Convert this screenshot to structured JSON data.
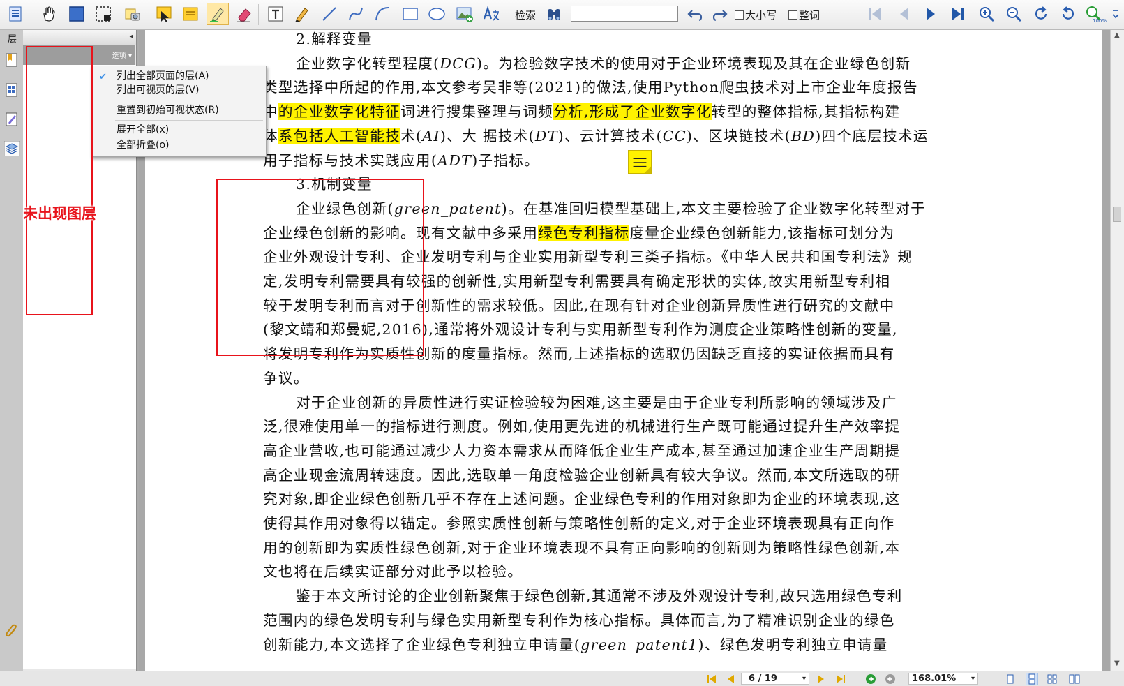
{
  "toolbar": {
    "search_label": "检索",
    "search_value": "",
    "match_case_label": "大小写",
    "whole_word_label": "整词",
    "zoom_badge": "100%",
    "icons": [
      "page-list-icon",
      "hand-tool-icon",
      "select-area-icon",
      "marquee-select-icon",
      "snapshot-icon",
      "select-text-icon",
      "sticky-note-icon",
      "highlight-icon",
      "eraser-icon",
      "text-box-icon",
      "pencil-icon",
      "line-icon",
      "curve-icon",
      "arc-icon",
      "rectangle-icon",
      "ellipse-icon",
      "image-icon",
      "translate-icon",
      "binoculars-icon",
      "undo-icon",
      "redo-icon",
      "first-page-icon",
      "prev-page-icon",
      "next-page-icon",
      "last-page-icon",
      "zoom-in-icon",
      "zoom-out-icon",
      "rotate-cw-icon",
      "rotate-ccw-icon",
      "zoom-100-icon",
      "toolbar-overflow-icon"
    ]
  },
  "panel": {
    "title": "层",
    "options_label": "选项",
    "collapse_glyph": "◂"
  },
  "menu": {
    "items": [
      {
        "label": "列出全部页面的层(A)",
        "checked": true
      },
      {
        "label": "列出可视页的层(V)",
        "checked": false
      },
      {
        "label": "重置到初始可视状态(R)",
        "checked": false
      },
      {
        "label": "展开全部(x)",
        "checked": false
      },
      {
        "label": "全部折叠(o)",
        "checked": false
      }
    ]
  },
  "annotation": {
    "text": "未出现图层",
    "color": "#e8131b"
  },
  "document": {
    "highlight_color": "#fff200",
    "lines": [
      [
        {
          "t": "2.解释变量"
        }
      ],
      [
        {
          "t": "企业数字化转型程度("
        },
        {
          "t": "DCG",
          "i": true
        },
        {
          "t": ")。为检验数字技术的使用对于企业环境表现及其在企业绿色创新"
        }
      ],
      [
        {
          "t": "类型选择中所起的作用,本文参考吴非等(2021)的做法,使用Python爬虫技术对上市企业年度报告"
        }
      ],
      [
        {
          "t": "中"
        },
        {
          "t": "的企业数字化特征",
          "h": true
        },
        {
          "t": "词进行搜集整理与词频"
        },
        {
          "t": "分析,形成了企业数字化",
          "h": true
        },
        {
          "t": "转型的整体指标,其指标构建"
        }
      ],
      [
        {
          "t": "体"
        },
        {
          "t": "系包括人工智能技",
          "h": true
        },
        {
          "t": "术("
        },
        {
          "t": "AI",
          "i": true
        },
        {
          "t": ")、大    据技术("
        },
        {
          "t": "DT",
          "i": true
        },
        {
          "t": ")、云计算技术("
        },
        {
          "t": "CC",
          "i": true
        },
        {
          "t": ")、区块链技术("
        },
        {
          "t": "BD",
          "i": true
        },
        {
          "t": ")四个底层技术运"
        }
      ],
      [
        {
          "t": "用子指标与技术实践应用("
        },
        {
          "t": "ADT",
          "i": true
        },
        {
          "t": ")子指标。"
        }
      ],
      [
        {
          "t": "3.机制变量"
        }
      ],
      [
        {
          "t": "企业绿色创新("
        },
        {
          "t": "green_patent",
          "i": true
        },
        {
          "t": ")。在基准回归模型基础上,本文主要检验了企业数字化转型对于"
        }
      ],
      [
        {
          "t": "企业绿色创新的影响。现有文献中多采用"
        },
        {
          "t": "绿色专利指标",
          "h": true
        },
        {
          "t": "度量企业绿色创新能力,该指标可划分为"
        }
      ],
      [
        {
          "t": "企业外观设计专利、企业发明专利与企业实用新型专利三类子指标。《中华人民共和国专利法》规"
        }
      ],
      [
        {
          "t": "定,发明专利需要具有较强的创新性,实用新型专利需要具有确定形状的实体,故实用新型专利相"
        }
      ],
      [
        {
          "t": "较于发明专利而言对于创新性的需求较低。因此,在现有针对企业创新异质性进行研究的文献中"
        }
      ],
      [
        {
          "t": "(黎文靖和郑曼妮,2016),通常将外观设计专利与实用新型专利作为测度企业策略性创新的变量,"
        }
      ],
      [
        {
          "t": "将发明专利作为实质性创新的度量指标。然而,上述指标的选取仍因缺乏直接的实证依据而具有"
        }
      ],
      [
        {
          "t": "争议。"
        }
      ],
      [
        {
          "t": "对于企业创新的异质性进行实证检验较为困难,这主要是由于企业专利所影响的领域涉及广"
        }
      ],
      [
        {
          "t": "泛,很难使用单一的指标进行测度。例如,使用更先进的机械进行生产既可能通过提升生产效率提"
        }
      ],
      [
        {
          "t": "高企业营收,也可能通过减少人力资本需求从而降低企业生产成本,甚至通过加速企业生产周期提"
        }
      ],
      [
        {
          "t": "高企业现金流周转速度。因此,选取单一角度检验企业创新具有较大争议。然而,本文所选取的研"
        }
      ],
      [
        {
          "t": "究对象,即企业绿色创新几乎不存在上述问题。企业绿色专利的作用对象即为企业的环境表现,这"
        }
      ],
      [
        {
          "t": "使得其作用对象得以锚定。参照实质性创新与策略性创新的定义,对于企业环境表现具有正向作"
        }
      ],
      [
        {
          "t": "用的创新即为实质性绿色创新,对于企业环境表现不具有正向影响的创新则为策略性绿色创新,本"
        }
      ],
      [
        {
          "t": "文也将在后续实证部分对此予以检验。"
        }
      ],
      [
        {
          "t": "鉴于本文所讨论的企业创新聚焦于绿色创新,其通常不涉及外观设计专利,故只选用绿色专利"
        }
      ],
      [
        {
          "t": "范围内的绿色发明专利与绿色实用新型专利作为核心指标。具体而言,为了精准识别企业的绿色"
        }
      ],
      [
        {
          "t": "创新能力,本文选择了企业绿色专利独立申请量("
        },
        {
          "t": "green_patent1",
          "i": true
        },
        {
          "t": ")、绿色发明专利独立申请量"
        }
      ]
    ]
  },
  "status": {
    "page_indicator": "6 / 19",
    "zoom": "168.01%"
  }
}
